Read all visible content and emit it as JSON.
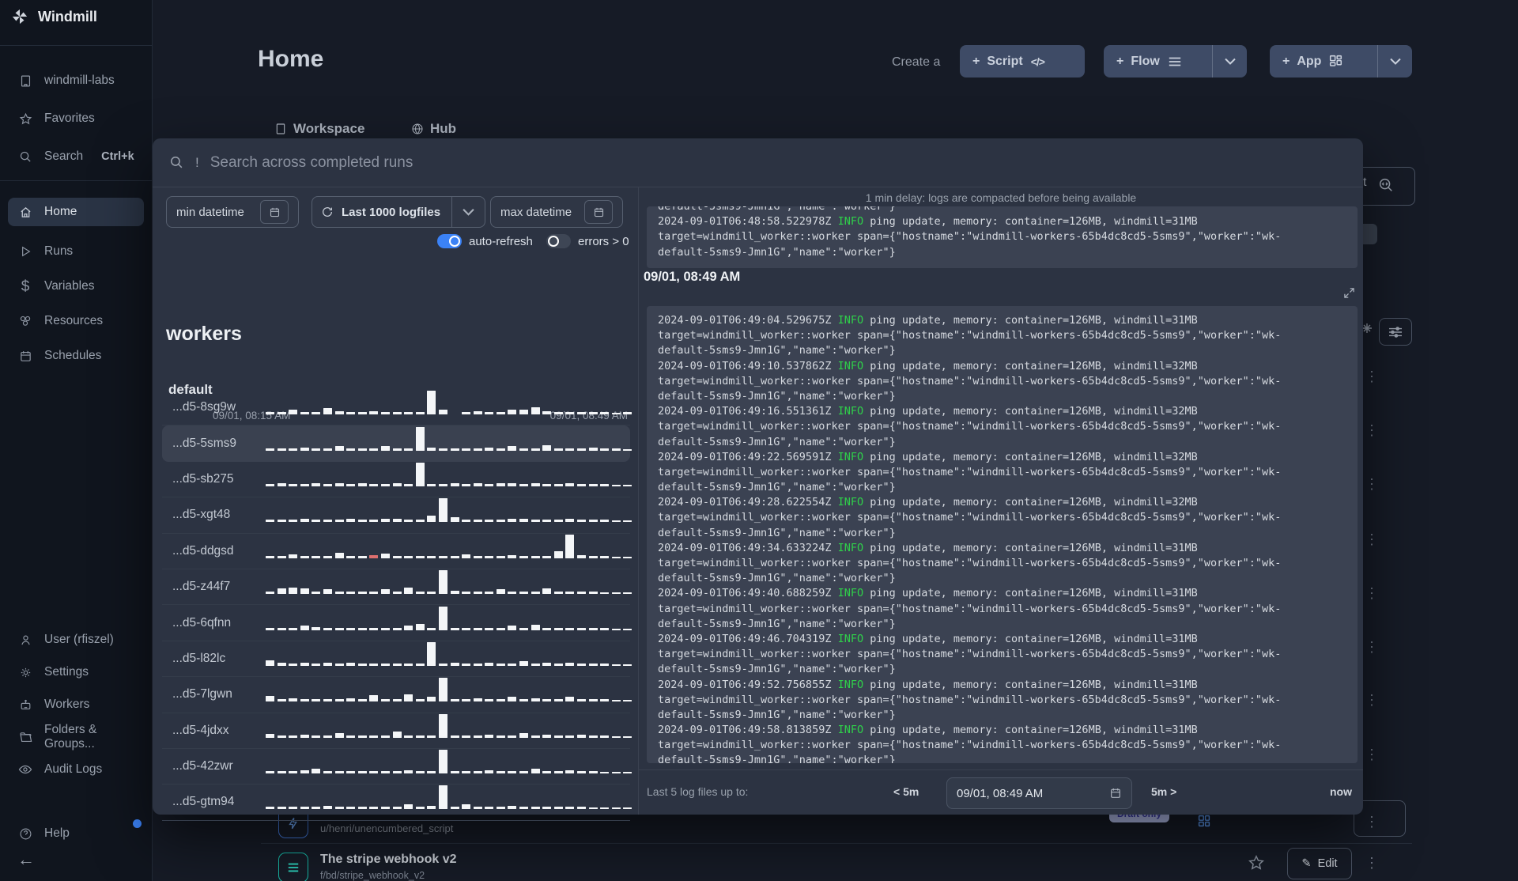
{
  "icons": {
    "dollar": "$",
    "kebab": "⋮",
    "pencil": "✎",
    "back": "←",
    "help": "?",
    "plus": "+",
    "code": "</>",
    "bang": "!"
  },
  "sidebar": {
    "brand": "Windmill",
    "top": [
      {
        "label": "windmill-labs"
      },
      {
        "label": "Favorites"
      },
      {
        "label": "Search",
        "kbd": "Ctrl+k"
      }
    ],
    "main": [
      {
        "label": "Home"
      },
      {
        "label": "Runs"
      },
      {
        "label": "Variables"
      },
      {
        "label": "Resources"
      },
      {
        "label": "Schedules"
      }
    ],
    "bottom": [
      {
        "label": "User (rfiszel)"
      },
      {
        "label": "Settings"
      },
      {
        "label": "Workers"
      },
      {
        "label": "Folders & Groups..."
      },
      {
        "label": "Audit Logs"
      }
    ],
    "help": "Help"
  },
  "header": {
    "title": "Home",
    "create": "Create a",
    "script": "Script",
    "flow": "Flow",
    "app": "App",
    "tabs": {
      "workspace": "Workspace",
      "hub": "Hub"
    }
  },
  "modal": {
    "search_placeholder": "Search across completed runs",
    "filters": {
      "min": "min datetime",
      "logfiles": "Last 1000 logfiles",
      "max": "max datetime",
      "auto_refresh": "auto-refresh",
      "errors": "errors > 0"
    },
    "range": {
      "start": "09/01, 08:15 AM",
      "end": "09/01, 08:49 AM"
    },
    "workers_title": "workers",
    "group_title": "default",
    "workers": [
      {
        "name": "...d5-8sg9w",
        "bars": [
          3,
          3,
          6,
          3,
          3,
          8,
          4,
          3,
          3,
          4,
          3,
          3,
          3,
          3,
          30,
          6,
          0,
          3,
          4,
          3,
          3,
          6,
          6,
          9,
          4,
          3,
          3,
          3,
          3,
          3,
          2,
          3
        ]
      },
      {
        "name": "...d5-5sms9",
        "selected": true,
        "bars": [
          3,
          3,
          3,
          4,
          3,
          3,
          6,
          3,
          3,
          3,
          6,
          3,
          3,
          30,
          4,
          3,
          3,
          3,
          3,
          4,
          3,
          6,
          3,
          3,
          7,
          3,
          3,
          3,
          4,
          3,
          3,
          2
        ]
      },
      {
        "name": "...d5-sb275",
        "bars": [
          3,
          4,
          3,
          3,
          4,
          3,
          4,
          3,
          4,
          3,
          3,
          4,
          3,
          30,
          3,
          3,
          4,
          3,
          4,
          3,
          4,
          4,
          3,
          4,
          3,
          3,
          4,
          3,
          3,
          3,
          2,
          2
        ]
      },
      {
        "name": "...d5-xgt48",
        "bars": [
          3,
          3,
          3,
          4,
          3,
          3,
          3,
          4,
          3,
          3,
          4,
          4,
          3,
          3,
          8,
          30,
          6,
          3,
          3,
          3,
          3,
          4,
          4,
          3,
          3,
          3,
          4,
          3,
          3,
          3,
          2,
          2
        ]
      },
      {
        "name": "...d5-ddgsd",
        "red_index": 9,
        "bars": [
          3,
          3,
          5,
          3,
          3,
          3,
          7,
          3,
          3,
          4,
          6,
          3,
          3,
          3,
          3,
          3,
          3,
          5,
          3,
          3,
          3,
          4,
          3,
          3,
          3,
          9,
          30,
          4,
          3,
          3,
          2,
          2
        ]
      },
      {
        "name": "...d5-z44f7",
        "bars": [
          3,
          7,
          8,
          7,
          3,
          6,
          3,
          3,
          3,
          3,
          6,
          3,
          8,
          3,
          3,
          30,
          4,
          3,
          3,
          3,
          6,
          3,
          3,
          3,
          7,
          3,
          3,
          3,
          3,
          2,
          2,
          2
        ]
      },
      {
        "name": "...d5-6qfnn",
        "bars": [
          3,
          3,
          3,
          6,
          4,
          3,
          3,
          3,
          3,
          3,
          3,
          3,
          6,
          8,
          3,
          30,
          3,
          3,
          3,
          3,
          3,
          6,
          3,
          7,
          3,
          3,
          3,
          3,
          3,
          3,
          2,
          2
        ]
      },
      {
        "name": "...d5-l82lc",
        "bars": [
          7,
          4,
          3,
          4,
          3,
          4,
          3,
          4,
          3,
          3,
          3,
          3,
          3,
          3,
          30,
          3,
          4,
          3,
          3,
          4,
          3,
          3,
          6,
          3,
          4,
          3,
          4,
          3,
          3,
          3,
          2,
          2
        ]
      },
      {
        "name": "...d5-7lgwn",
        "bars": [
          7,
          3,
          4,
          3,
          3,
          3,
          3,
          4,
          3,
          8,
          3,
          3,
          9,
          3,
          6,
          30,
          3,
          3,
          4,
          3,
          3,
          6,
          3,
          4,
          3,
          3,
          6,
          3,
          3,
          3,
          2,
          2
        ]
      },
      {
        "name": "...d5-4jdxx",
        "bars": [
          5,
          3,
          3,
          4,
          3,
          3,
          6,
          3,
          3,
          3,
          3,
          8,
          3,
          3,
          3,
          30,
          3,
          3,
          3,
          4,
          3,
          3,
          6,
          3,
          4,
          3,
          3,
          4,
          3,
          3,
          2,
          2
        ]
      },
      {
        "name": "...d5-42zwr",
        "bars": [
          3,
          3,
          3,
          4,
          6,
          3,
          3,
          3,
          3,
          3,
          3,
          3,
          4,
          3,
          3,
          30,
          3,
          3,
          3,
          4,
          3,
          3,
          3,
          6,
          3,
          3,
          4,
          3,
          3,
          2,
          2,
          2
        ]
      },
      {
        "name": "...d5-gtm94",
        "bars": [
          3,
          3,
          3,
          3,
          3,
          4,
          3,
          3,
          3,
          3,
          3,
          3,
          6,
          3,
          4,
          30,
          3,
          6,
          3,
          3,
          3,
          4,
          3,
          3,
          3,
          3,
          3,
          3,
          2,
          2,
          2,
          2
        ]
      }
    ],
    "logs": {
      "notice": "1 min delay: logs are compacted before being available",
      "level": "INFO",
      "line1_mid": " ping update, memory: container=126MB, windmill=",
      "line2": "target=windmill_worker::worker span={\"hostname\":\"windmill-workers-65b4dc8cd5-5sms9\",\"worker\":\"wk-",
      "line3": "default-5sms9-Jmn1G\",\"name\":\"worker\"}",
      "prev_entry": {
        "time": "2024-09-01T06:48:58.522978Z",
        "mem": "31MB"
      },
      "section_header": "09/01, 08:49 AM",
      "entries": [
        {
          "time": "2024-09-01T06:49:04.529675Z",
          "mem": "31MB"
        },
        {
          "time": "2024-09-01T06:49:10.537862Z",
          "mem": "32MB"
        },
        {
          "time": "2024-09-01T06:49:16.551361Z",
          "mem": "32MB"
        },
        {
          "time": "2024-09-01T06:49:22.569591Z",
          "mem": "32MB"
        },
        {
          "time": "2024-09-01T06:49:28.622554Z",
          "mem": "32MB"
        },
        {
          "time": "2024-09-01T06:49:34.633224Z",
          "mem": "31MB"
        },
        {
          "time": "2024-09-01T06:49:40.688259Z",
          "mem": "31MB"
        },
        {
          "time": "2024-09-01T06:49:46.704319Z",
          "mem": "31MB"
        },
        {
          "time": "2024-09-01T06:49:52.756855Z",
          "mem": "31MB"
        },
        {
          "time": "2024-09-01T06:49:58.813859Z",
          "mem": "31MB"
        }
      ]
    },
    "footer": {
      "label": "Last 5 log files up to:",
      "back": "< 5m",
      "datetime": "09/01, 08:49 AM",
      "fwd": "5m >",
      "now": "now"
    }
  },
  "background": {
    "search_fragment": "t",
    "row1": {
      "path": "u/henri/unencumbered_script",
      "badge": "Draft only"
    },
    "row2": {
      "title": "The stripe webhook v2",
      "path": "f/bd/stripe_webhook_v2",
      "edit": "Edit"
    }
  }
}
